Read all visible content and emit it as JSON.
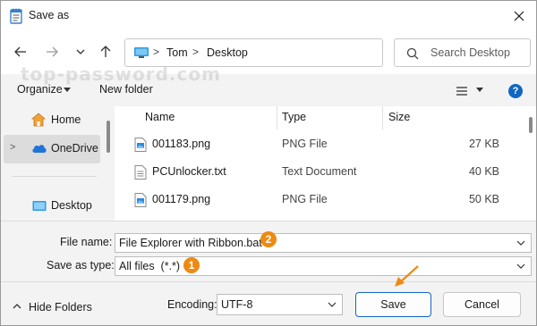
{
  "window": {
    "title": "Save as",
    "close_icon": "close-icon",
    "title_icon": "notepad-icon"
  },
  "nav": {
    "back_icon": "arrow-left-icon",
    "forward_icon": "arrow-right-icon",
    "recent_icon": "chevron-down-icon",
    "up_icon": "arrow-up-icon"
  },
  "address": {
    "icon": "this-pc-icon",
    "parts": [
      "Tom",
      "Desktop"
    ],
    "separator": ">"
  },
  "search": {
    "placeholder": "Search Desktop",
    "icon": "search-icon"
  },
  "watermark": "top-password.com",
  "toolbar": {
    "organize_label": "Organize",
    "new_folder_label": "New folder",
    "help_label": "?"
  },
  "nav_pane": {
    "items": [
      {
        "label": "Home",
        "icon": "home-icon",
        "selected": false
      },
      {
        "label": "OneDrive",
        "icon": "cloud-icon",
        "selected": true,
        "expand": ">"
      },
      {
        "label": "Desktop",
        "icon": "desktop-icon",
        "selected": false
      }
    ]
  },
  "file_list": {
    "columns": [
      "Name",
      "Type",
      "Size"
    ],
    "rows": [
      {
        "name": "001183.png",
        "type": "PNG File",
        "size": "27 KB",
        "icon": "image-file-icon"
      },
      {
        "name": "PCUnlocker.txt",
        "type": "Text Document",
        "size": "40 KB",
        "icon": "text-file-icon"
      },
      {
        "name": "001179.png",
        "type": "PNG File",
        "size": "50 KB",
        "icon": "image-file-icon"
      }
    ]
  },
  "form": {
    "file_name_label": "File name:",
    "file_name_value": "File Explorer with Ribbon.bat",
    "file_name_badge": "2",
    "save_as_type_label": "Save as type:",
    "save_as_type_value": "All files  (*.*)",
    "save_as_type_badge": "1",
    "encoding_label": "Encoding:",
    "encoding_value": "UTF-8"
  },
  "footer": {
    "hide_folders_label": "Hide Folders",
    "save_label": "Save",
    "cancel_label": "Cancel"
  },
  "colors": {
    "accent": "#1166c4",
    "badge": "#ee8a12",
    "folder_blue": "#2a8be0"
  }
}
